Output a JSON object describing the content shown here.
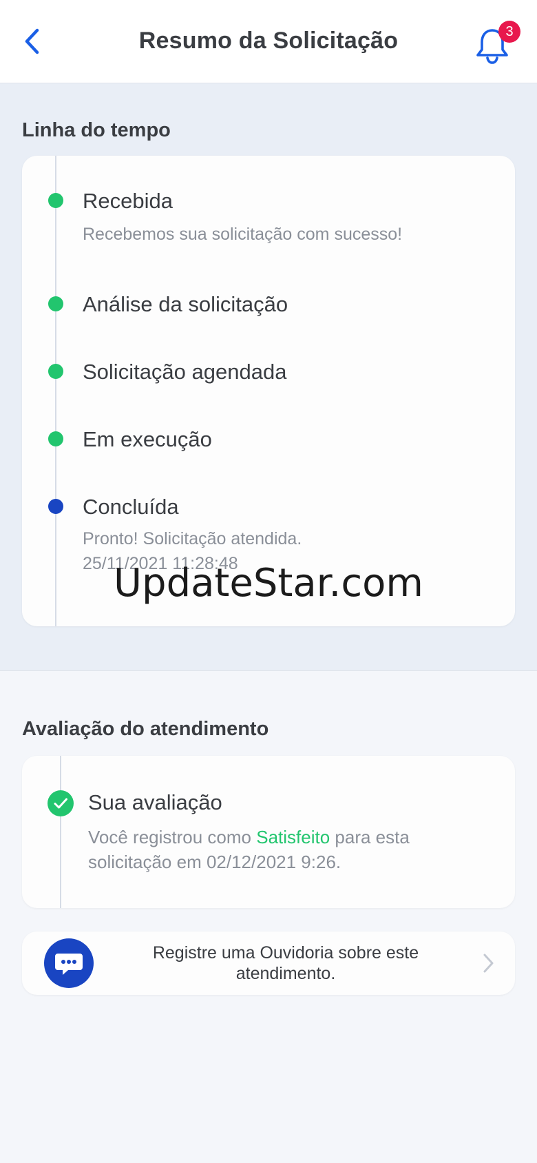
{
  "header": {
    "title": "Resumo da Solicitação",
    "notification_count": "3",
    "back_icon": "chevron-left-icon",
    "bell_icon": "bell-icon"
  },
  "timeline": {
    "section_title": "Linha do tempo",
    "steps": [
      {
        "title": "Recebida",
        "subtitle": "Recebemos sua solicitação com sucesso!",
        "status": "done"
      },
      {
        "title": "Análise da solicitação",
        "status": "done"
      },
      {
        "title": "Solicitação agendada",
        "status": "done"
      },
      {
        "title": "Em execução",
        "status": "done"
      },
      {
        "title": "Concluída",
        "subtitle": "Pronto! Solicitação atendida.",
        "timestamp": "25/11/2021 11:28:48",
        "status": "current"
      }
    ]
  },
  "evaluation": {
    "section_title": "Avaliação do atendimento",
    "title": "Sua avaliação",
    "text_prefix": "Você registrou como ",
    "rating": "Satisfeito",
    "text_suffix": " para esta",
    "text_line2": "solicitação em 02/12/2021 9:26."
  },
  "ombudsman": {
    "line1": "Registre uma Ouvidoria sobre este",
    "line2": "atendimento.",
    "icon": "chat-bubble-icon"
  },
  "watermark": "UpdateStar.com",
  "colors": {
    "accent": "#1a5fe6",
    "done": "#22c56e",
    "current": "#1945c2",
    "badge": "#e8184d"
  }
}
